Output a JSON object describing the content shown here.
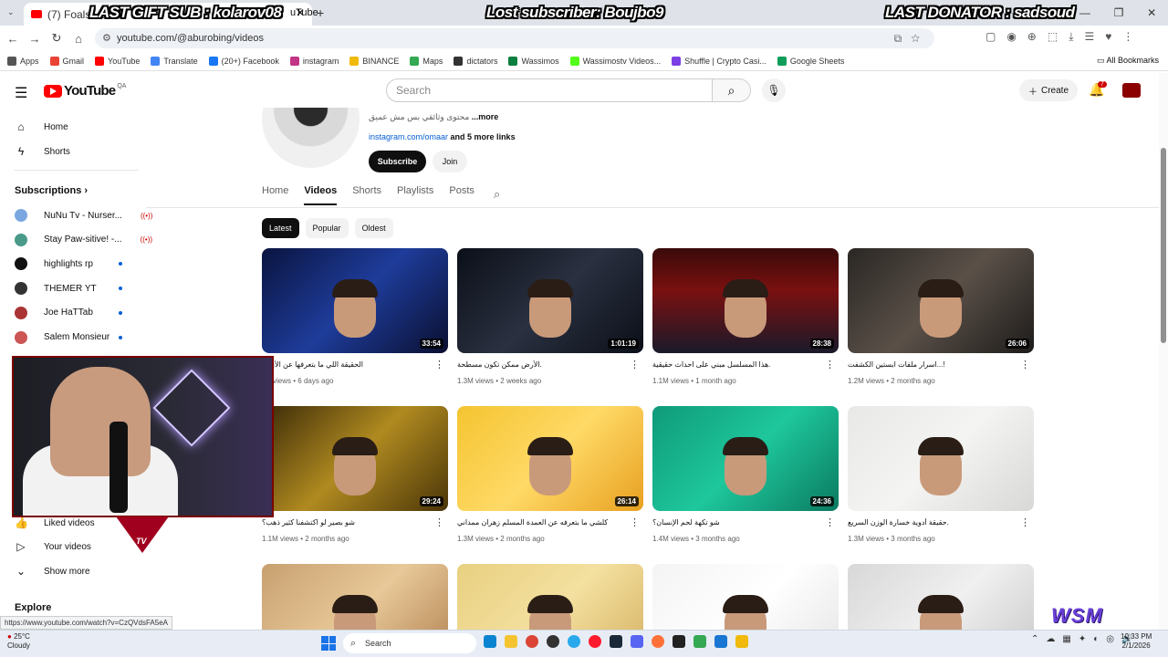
{
  "browser": {
    "tab_title": "(7) Foals - Late",
    "tab_title_tail": "uTube",
    "url": "youtube.com/@aburobing/videos",
    "bookmarks": [
      {
        "label": "Apps",
        "color": "#555"
      },
      {
        "label": "Gmail",
        "color": "#ea4335"
      },
      {
        "label": "YouTube",
        "color": "#ff0000"
      },
      {
        "label": "Translate",
        "color": "#4285f4"
      },
      {
        "label": "(20+) Facebook",
        "color": "#1877f2"
      },
      {
        "label": "instagram",
        "color": "#c13584"
      },
      {
        "label": "BINANCE",
        "color": "#f0b90b"
      },
      {
        "label": "Maps",
        "color": "#34a853"
      },
      {
        "label": "dictators",
        "color": "#333"
      },
      {
        "label": "Wassimos",
        "color": "#0a7f3f"
      },
      {
        "label": "Wassimostv Videos...",
        "color": "#53fc18"
      },
      {
        "label": "Shuffle | Crypto Casi...",
        "color": "#7b3fe4"
      },
      {
        "label": "Google Sheets",
        "color": "#0f9d58"
      }
    ],
    "all_bookmarks": "All Bookmarks",
    "status_url": "https://www.youtube.com/watch?v=CzQVdsFA5eA"
  },
  "stream_overlay": {
    "gift": "LAST GIFT SUB : kolarov08",
    "lost": "Lost subscriber: Boujbo9",
    "donator": "LAST DONATOR : sadsoud",
    "brand": "WSM",
    "brand_sub": "TV"
  },
  "youtube": {
    "logo": "YouTube",
    "region": "QA",
    "search_placeholder": "Search",
    "create_label": "Create",
    "notif_count": "7"
  },
  "sidebar": {
    "home": "Home",
    "shorts": "Shorts",
    "subscriptions_title": "Subscriptions",
    "subs": [
      {
        "name": "NuNu Tv - Nurser...",
        "live": true,
        "color": "#7aa7e0"
      },
      {
        "name": "Stay Paw-sitive! -...",
        "live": true,
        "color": "#4a9a8a"
      },
      {
        "name": "highlights rp",
        "live": false,
        "color": "#111"
      },
      {
        "name": "THEMER YT",
        "live": false,
        "color": "#333"
      },
      {
        "name": "Joe HaTTab",
        "live": false,
        "color": "#a33"
      },
      {
        "name": "Salem Monsieur",
        "live": false,
        "color": "#c55"
      }
    ],
    "liked": "Liked videos",
    "your_videos": "Your videos",
    "show_more": "Show more",
    "explore": "Explore"
  },
  "channel": {
    "description": "محتوى وثائقي بس مش عميق",
    "more": "...more",
    "link": "instagram.com/omaar",
    "more_links": "and 5 more links",
    "subscribe": "Subscribe",
    "join": "Join",
    "tabs": [
      "Home",
      "Videos",
      "Shorts",
      "Playlists",
      "Posts"
    ],
    "chips": [
      "Latest",
      "Popular",
      "Oldest"
    ]
  },
  "videos": [
    {
      "title": "الحقيقة اللي ما بتعرفها عن الأبراج",
      "views": "1K views",
      "age": "6 days ago",
      "duration": "33:54",
      "bg": "linear-gradient(135deg,#0a1440,#1e3c9a 50%,#0a0f30)"
    },
    {
      "title": ".الأرض ممكن تكون مسطحة",
      "views": "1.3M views",
      "age": "2 weeks ago",
      "duration": "1:01:19",
      "bg": "linear-gradient(135deg,#0b0f18,#2a3040 50%,#0b0f18)"
    },
    {
      "title": ".هذا المسلسل مبني على احداث حقيقية",
      "views": "1.1M views",
      "age": "1 month ago",
      "duration": "28:38",
      "bg": "linear-gradient(180deg,#3a0a0a,#7a1010 40%,#1a1a2a)"
    },
    {
      "title": "!...اسرار ملفات ابستين الكشفت",
      "views": "1.2M views",
      "age": "2 months ago",
      "duration": "26:06",
      "bg": "linear-gradient(135deg,#2a2724,#5a5048 50%,#1e1c1a)"
    },
    {
      "title": "شو بصير لو اكتشفنا كثير ذهب؟",
      "views": "1.1M views",
      "age": "2 months ago",
      "duration": "29:24",
      "bg": "linear-gradient(135deg,#3a2a08,#b08a20 50%,#4a3508)"
    },
    {
      "title": "كلشي ما بتعرفه عن العمدة المسلم زهران ممداني",
      "views": "1.3M views",
      "age": "2 months ago",
      "duration": "26:14",
      "bg": "linear-gradient(135deg,#f4c430,#ffd966 50%,#e8a020)"
    },
    {
      "title": "شو تكهة لحم الإنسان؟",
      "views": "1.4M views",
      "age": "3 months ago",
      "duration": "24:36",
      "bg": "linear-gradient(135deg,#0f9a7a,#1ec79c 50%,#0a7a60)"
    },
    {
      "title": ".حقيقة أدوية خسارة الوزن السريع",
      "views": "1.3M views",
      "age": "3 months ago",
      "duration": "",
      "bg": "linear-gradient(135deg,#e8e8e6,#f4f4f2 50%,#d8d8d6)"
    },
    {
      "title": "",
      "views": "",
      "age": "",
      "duration": "",
      "bg": "linear-gradient(135deg,#c8a070,#e8c898 50%,#b08050)"
    },
    {
      "title": "",
      "views": "",
      "age": "",
      "duration": "",
      "bg": "linear-gradient(135deg,#e8d080,#f4e0a0 50%,#d4b060)"
    },
    {
      "title": "",
      "views": "",
      "age": "",
      "duration": "",
      "bg": "linear-gradient(135deg,#f4f4f4,#ffffff 50%,#e4e4e4)"
    },
    {
      "title": "",
      "views": "",
      "age": "",
      "duration": "",
      "bg": "linear-gradient(135deg,#d8d8d8,#f0f0f0 50%,#c8c8c8)"
    }
  ],
  "taskbar": {
    "temp": "25°C",
    "weather": "Cloudy",
    "search": "Search",
    "time": "10:33 PM",
    "date": "2/1/2026"
  }
}
